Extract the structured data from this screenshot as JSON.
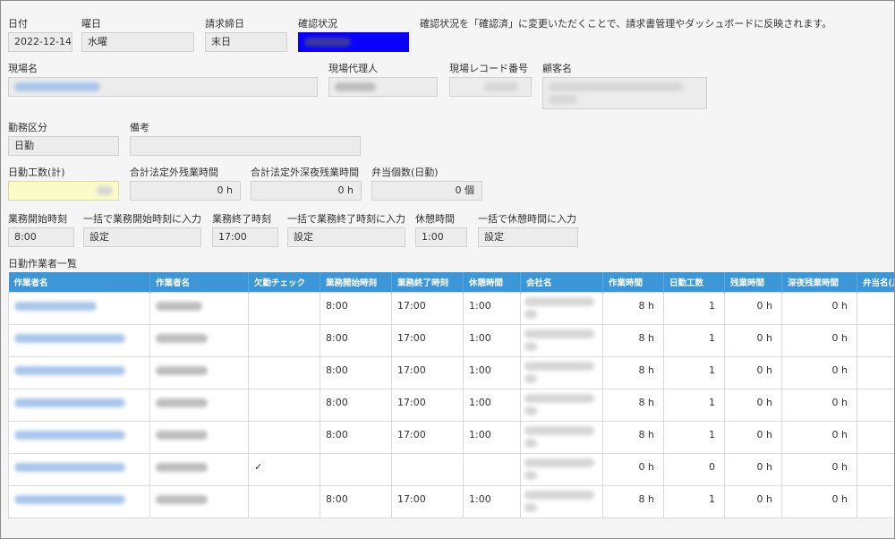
{
  "header": {
    "date_label": "日付",
    "date_value": "2022-12-14",
    "weekday_label": "曜日",
    "weekday_value": "水曜",
    "closing_label": "請求締日",
    "closing_value": "末日",
    "status_label": "確認状況",
    "status_value": "確認済",
    "status_color": "#0a00ff",
    "status_note": "確認状況を「確認済」に変更いただくことで、請求書管理やダッシュボードに反映されます。"
  },
  "site": {
    "name_label": "現場名",
    "agent_label": "現場代理人",
    "record_label": "現場レコード番号",
    "customer_label": "顧客名"
  },
  "work": {
    "type_label": "勤務区分",
    "type_value": "日勤",
    "note_label": "備考",
    "note_value": ""
  },
  "totals": {
    "day_work_label": "日勤工数(計)",
    "overtime_label": "合計法定外残業時間",
    "overtime_value": "0 h",
    "late_overtime_label": "合計法定外深夜残業時間",
    "late_overtime_value": "0 h",
    "lunch_label": "弁当個数(日勤)",
    "lunch_value": "0 個"
  },
  "times": {
    "start_label": "業務開始時刻",
    "start_value": "8:00",
    "bulk_start_label": "一括で業務開始時刻に入力",
    "bulk_start_value": "設定",
    "end_label": "業務終了時刻",
    "end_value": "17:00",
    "bulk_end_label": "一括で業務終了時刻に入力",
    "bulk_end_value": "設定",
    "break_label": "休憩時間",
    "break_value": "1:00",
    "bulk_break_label": "一括で休憩時間に入力",
    "bulk_break_value": "設定"
  },
  "workers": {
    "section_title": "日勤作業者一覧",
    "columns": [
      "作業者名",
      "作業者名",
      "欠勤チェック",
      "業務開始時刻",
      "業務終了時刻",
      "休憩時間",
      "会社名",
      "作業時間",
      "日勤工数",
      "残業時間",
      "深夜残業時間",
      "弁当名(月"
    ],
    "rows": [
      {
        "absent": "",
        "start": "8:00",
        "end": "17:00",
        "break": "1:00",
        "work_time": "8 h",
        "day_count": "1",
        "overtime": "0 h",
        "late_overtime": "0 h"
      },
      {
        "absent": "",
        "start": "8:00",
        "end": "17:00",
        "break": "1:00",
        "work_time": "8 h",
        "day_count": "1",
        "overtime": "0 h",
        "late_overtime": "0 h"
      },
      {
        "absent": "",
        "start": "8:00",
        "end": "17:00",
        "break": "1:00",
        "work_time": "8 h",
        "day_count": "1",
        "overtime": "0 h",
        "late_overtime": "0 h"
      },
      {
        "absent": "",
        "start": "8:00",
        "end": "17:00",
        "break": "1:00",
        "work_time": "8 h",
        "day_count": "1",
        "overtime": "0 h",
        "late_overtime": "0 h"
      },
      {
        "absent": "",
        "start": "8:00",
        "end": "17:00",
        "break": "1:00",
        "work_time": "8 h",
        "day_count": "1",
        "overtime": "0 h",
        "late_overtime": "0 h"
      },
      {
        "absent": "✓",
        "start": "",
        "end": "",
        "break": "",
        "work_time": "0 h",
        "day_count": "0",
        "overtime": "0 h",
        "late_overtime": "0 h"
      },
      {
        "absent": "",
        "start": "8:00",
        "end": "17:00",
        "break": "1:00",
        "work_time": "8 h",
        "day_count": "1",
        "overtime": "0 h",
        "late_overtime": "0 h"
      }
    ]
  }
}
